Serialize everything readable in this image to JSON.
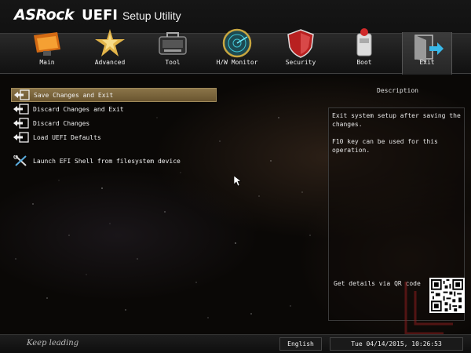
{
  "header": {
    "logo": "ASRock",
    "product": "UEFI",
    "subtitle": "Setup Utility"
  },
  "tabs": [
    {
      "label": "Main",
      "icon": "main-icon"
    },
    {
      "label": "Advanced",
      "icon": "advanced-icon"
    },
    {
      "label": "Tool",
      "icon": "tool-icon"
    },
    {
      "label": "H/W Monitor",
      "icon": "radar-icon"
    },
    {
      "label": "Security",
      "icon": "shield-icon"
    },
    {
      "label": "Boot",
      "icon": "boot-icon"
    },
    {
      "label": "Exit",
      "icon": "exit-icon",
      "active": true
    }
  ],
  "menu": [
    {
      "label": "Save Changes and Exit",
      "icon": "exit-arrow-icon",
      "selected": true
    },
    {
      "label": "Discard Changes and Exit",
      "icon": "exit-arrow-icon"
    },
    {
      "label": "Discard Changes",
      "icon": "exit-arrow-icon"
    },
    {
      "label": "Load UEFI Defaults",
      "icon": "exit-arrow-icon"
    },
    {
      "label": "Launch EFI Shell from filesystem device",
      "icon": "wrench-icon"
    }
  ],
  "description": {
    "title": "Description",
    "text": "Exit system setup after saving the\nchanges.\n\nF10 key can be used for this\noperation.",
    "qr_label": "Get details via QR code"
  },
  "footer": {
    "slogan": "Keep leading",
    "language": "English",
    "datetime": "Tue 04/14/2015, 10:26:53"
  },
  "colors": {
    "selected_bg": "#7a6540",
    "background": "#0a0806",
    "text": "#f0f0f0"
  }
}
